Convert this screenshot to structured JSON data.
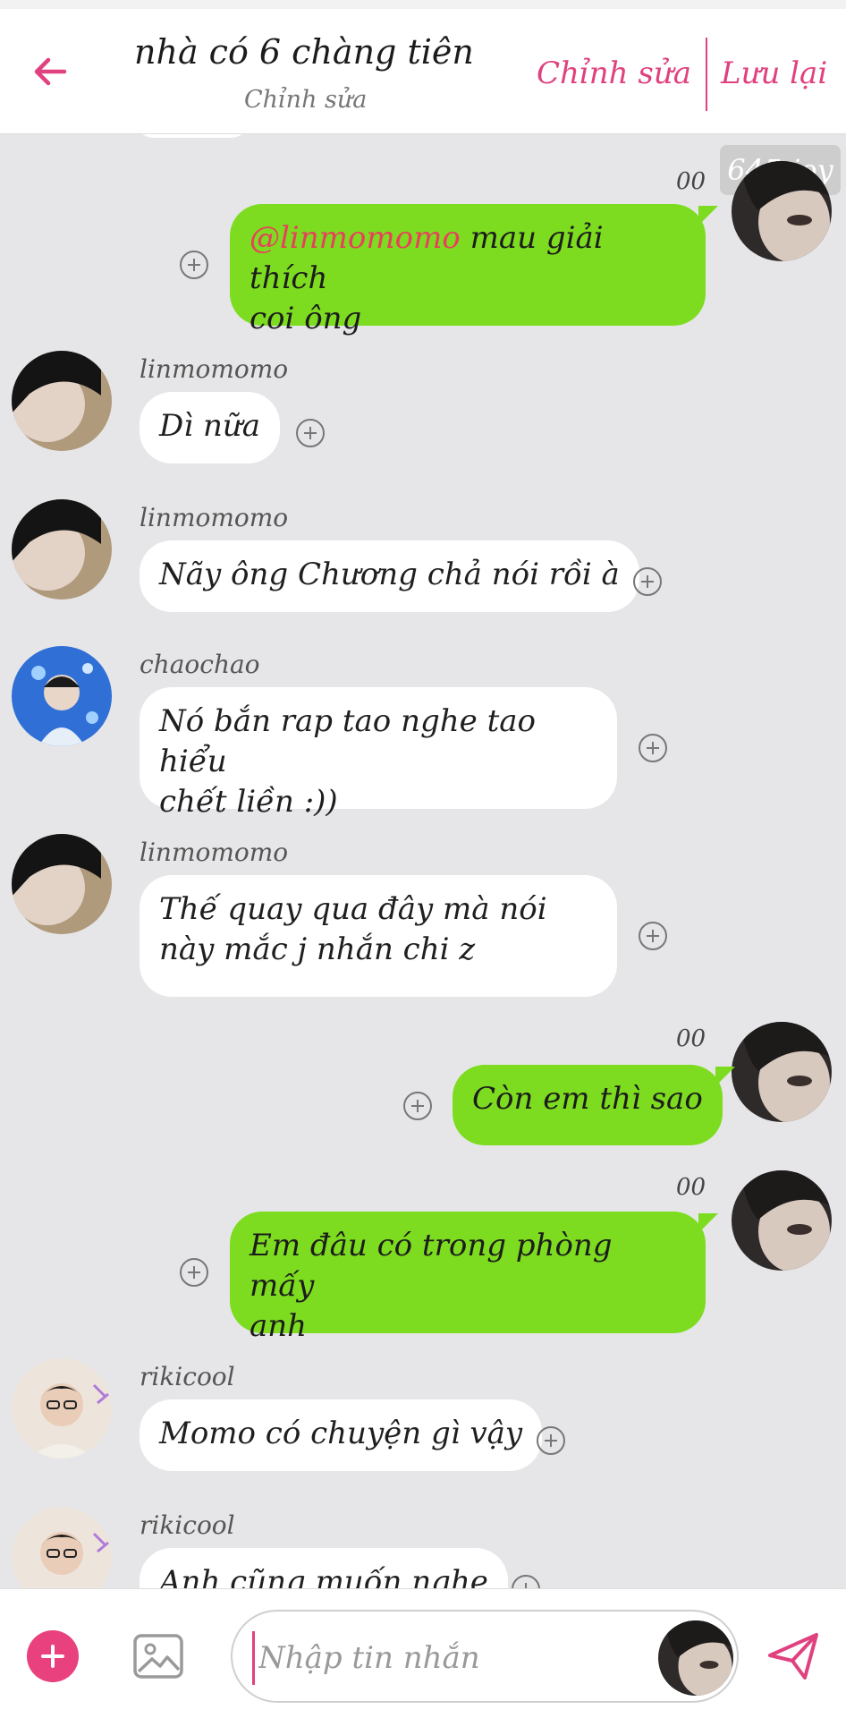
{
  "header": {
    "title": "nhà có 6 chàng tiên",
    "subtitle": "Chỉnh sửa",
    "edit_label": "Chỉnh sửa",
    "save_label": "Lưu lại"
  },
  "watermark": "645 joy",
  "messages": [
    {
      "side": "out",
      "read_mark": "00",
      "mention": "@linmomomo",
      "text_line1": " mau giải thích",
      "text_line2": "coi ông"
    },
    {
      "side": "in",
      "sender": "linmomomo",
      "text": "Dì nữa"
    },
    {
      "side": "in",
      "sender": "linmomomo",
      "text": "Nãy ông Chương chả nói rồi à"
    },
    {
      "side": "in",
      "sender": "chaochao",
      "text_line1": "Nó bắn rap tao nghe tao hiểu",
      "text_line2": "chết liền :))"
    },
    {
      "side": "in",
      "sender": "linmomomo",
      "text_line1": "Thế quay qua đây mà nói",
      "text_line2": "này mắc j nhắn chi z"
    },
    {
      "side": "out",
      "read_mark": "00",
      "text": "Còn em thì sao"
    },
    {
      "side": "out",
      "read_mark": "00",
      "text_line1": "Em đâu có trong phòng mấy",
      "text_line2": "anh"
    },
    {
      "side": "in",
      "sender": "rikicool",
      "text": "Momo có chuyện gì vậy"
    },
    {
      "side": "in",
      "sender": "rikicool",
      "text": "Anh cũng muốn nghe"
    }
  ],
  "composer": {
    "placeholder": "Nhập tin nhắn"
  },
  "colors": {
    "accent": "#e0417f",
    "outgoing_bubble": "#7ddc1f",
    "incoming_bubble": "#ffffff",
    "mention": "#e8405c",
    "background": "#e6e6e8"
  },
  "icons": {
    "back": "arrow-left-icon",
    "plus": "circle-plus-icon",
    "add": "plus-icon",
    "image": "image-icon",
    "send": "send-icon"
  }
}
